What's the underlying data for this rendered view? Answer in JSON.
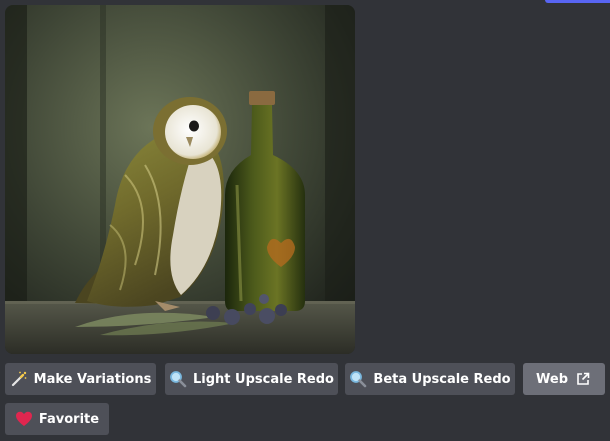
{
  "buttons": {
    "make_variations": "Make Variations",
    "light_upscale_redo": "Light Upscale Redo",
    "beta_upscale_redo": "Beta Upscale Redo",
    "web": "Web",
    "favorite": "Favorite"
  },
  "icons": {
    "make_variations": "magic-wand-icon",
    "light_upscale_redo": "magnifying-glass-icon",
    "beta_upscale_redo": "magnifying-glass-icon",
    "web": "external-link-icon",
    "favorite": "heart-icon"
  },
  "colors": {
    "background": "#313338",
    "button": "#4e5058",
    "link_button": "#6d6f78",
    "accent": "#5865f2",
    "heart": "#e0264f"
  }
}
